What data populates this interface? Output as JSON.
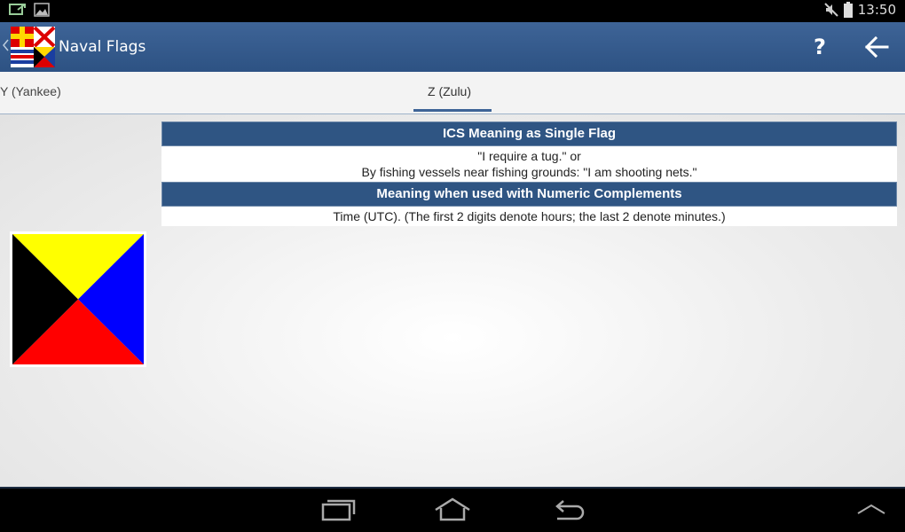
{
  "status_bar": {
    "time": "13:50"
  },
  "app": {
    "title": "Naval Flags"
  },
  "toolbar": {
    "help_label": "?"
  },
  "tabs": [
    {
      "label": "Y (Yankee)",
      "selected": false
    },
    {
      "label": "Z (Zulu)",
      "selected": true
    }
  ],
  "flag": {
    "letter": "Z",
    "colors": {
      "top": "#ffff00",
      "right": "#0000ff",
      "bottom": "#ff0000",
      "left": "#000000"
    }
  },
  "meaning": {
    "single_header": "ICS Meaning as Single Flag",
    "single_line1": "\"I require a tug.\" or",
    "single_line2": "By fishing vessels near fishing grounds: \"I am shooting nets.\"",
    "numeric_header": "Meaning when used with Numeric Complements",
    "numeric_text": "Time (UTC). (The first 2 digits denote hours; the last 2 denote minutes.)"
  },
  "colors": {
    "accent": "#2f5583"
  }
}
